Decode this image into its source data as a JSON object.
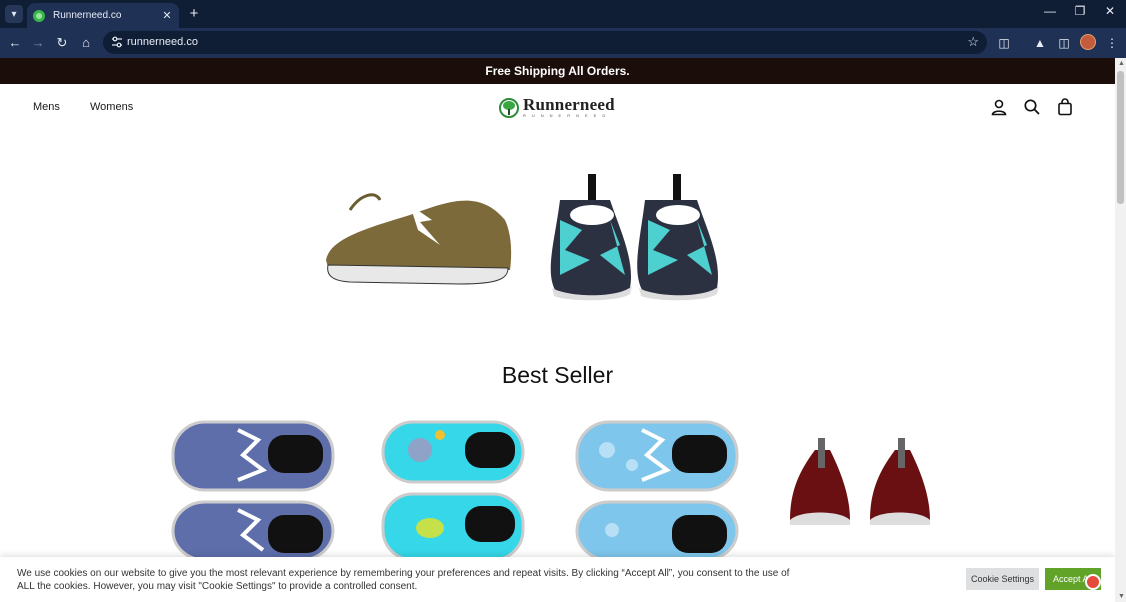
{
  "browser": {
    "tab_title": "Runnerneed.co",
    "url": "runnerneed.co",
    "icons": [
      "tab-search-icon",
      "favicon",
      "close-icon",
      "plus-icon",
      "minimize-icon",
      "restore-icon",
      "close-window-icon",
      "back-icon",
      "forward-icon",
      "reload-icon",
      "home-icon",
      "site-info-icon",
      "star-icon",
      "extensions-icon",
      "labs-icon",
      "side-panel-icon",
      "profile-avatar",
      "menu-icon"
    ]
  },
  "announcement": {
    "text": "Free Shipping All Orders."
  },
  "header": {
    "nav": [
      "Mens",
      "Womens"
    ],
    "logo_name": "Runnerneed",
    "logo_sub": "RUNNERNEED",
    "icons": [
      "account-icon",
      "search-icon",
      "cart-icon"
    ]
  },
  "hero": {
    "products": [
      "brown-sneaker-image",
      "teal-black-sneakers-image"
    ]
  },
  "best_seller": {
    "title": "Best Seller",
    "products": [
      "blue-denim-shoes",
      "cyan-cartoon-shoes",
      "light-blue-pattern-shoes",
      "dark-red-shoes"
    ]
  },
  "cookie": {
    "text": "We use cookies on our website to give you the most relevant experience by remembering your preferences and repeat visits. By clicking “Accept All”, you consent to the use of ALL the cookies. However, you may visit \"Cookie Settings\" to provide a controlled consent.",
    "settings_label": "Cookie Settings",
    "accept_label": "Accept All"
  },
  "colors": {
    "announcement_bg": "#1b0e0a",
    "accept_green": "#61a229",
    "browser_tab_bg": "#0f1d35",
    "browser_toolbar_bg": "#1f3154"
  }
}
